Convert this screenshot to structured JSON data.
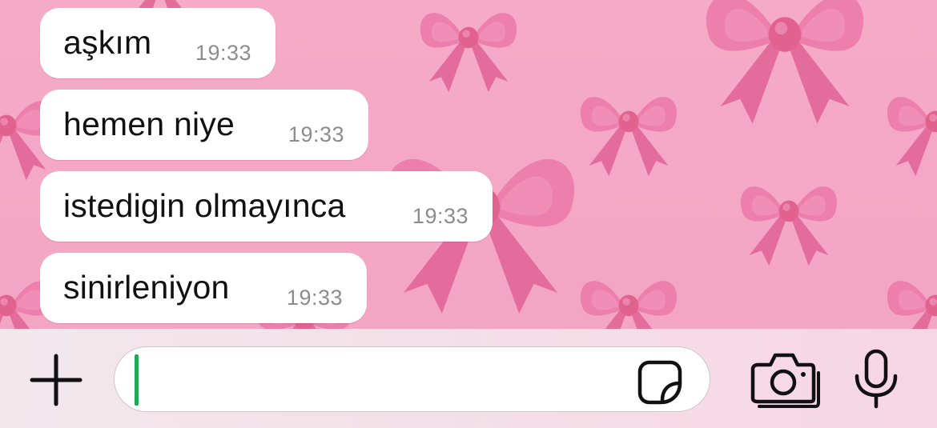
{
  "chat": {
    "messages": [
      {
        "text": "aşkım",
        "time": "19:33"
      },
      {
        "text": "hemen niye",
        "time": "19:33"
      },
      {
        "text": "istedigin olmayınca",
        "time": "19:33"
      },
      {
        "text": "sinirleniyon",
        "time": "19:33"
      }
    ],
    "wallpaper": {
      "motif": "pink-bow",
      "background_color": "#f4a7c4",
      "bow_color": "#e9719f"
    }
  },
  "composer": {
    "input_value": "",
    "caret_color": "#1fa855",
    "icons": {
      "add": "plus-icon",
      "sticker": "sticker-icon",
      "camera": "camera-icon",
      "voice": "microphone-icon"
    }
  }
}
